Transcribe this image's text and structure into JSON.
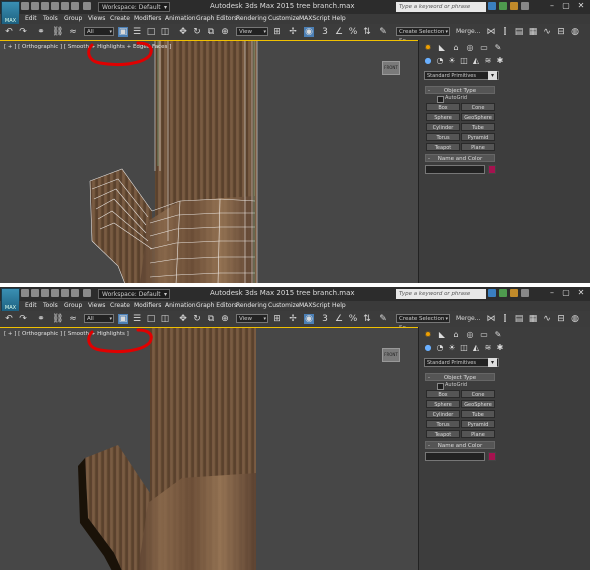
{
  "colors": {
    "annotation": "#e00000",
    "viewport_border": "#f0c000",
    "swatch": "#a5124f"
  },
  "app": {
    "logo_text": "MAX",
    "workspace": "Workspace: Default",
    "title": "Autodesk 3ds Max 2015    tree branch.max",
    "search_placeholder": "Type a keyword or phrase",
    "window_controls": [
      "–",
      "▢",
      "✕"
    ]
  },
  "menu": [
    "Edit",
    "Tools",
    "Group",
    "Views",
    "Create",
    "Modifiers",
    "Animation",
    "Graph Editors",
    "Rendering",
    "Customize",
    "MAXScript",
    "Help"
  ],
  "toolbar": {
    "selection_filter": "All",
    "ref_coord": "View",
    "selection_set": "Create Selection Se",
    "merge": "Merge..."
  },
  "command_panel": {
    "primitive_type": "Standard Primitives",
    "object_type_title": "Object Type",
    "autogrid_label": "AutoGrid",
    "buttons": [
      "Box",
      "Cone",
      "Sphere",
      "GeoSphere",
      "Cylinder",
      "Tube",
      "Torus",
      "Pyramid",
      "Teapot",
      "Plane"
    ],
    "name_color_title": "Name and Color"
  },
  "panels": [
    {
      "viewport_label": "[ + ] [ Orthographic ] [ Smooth + Highlights + Edged Faces ]",
      "view_cube_label": "FRONT"
    },
    {
      "viewport_label": "[ + ] [ Orthographic ] [ Smooth + Highlights ]",
      "view_cube_label": "FRONT"
    }
  ]
}
